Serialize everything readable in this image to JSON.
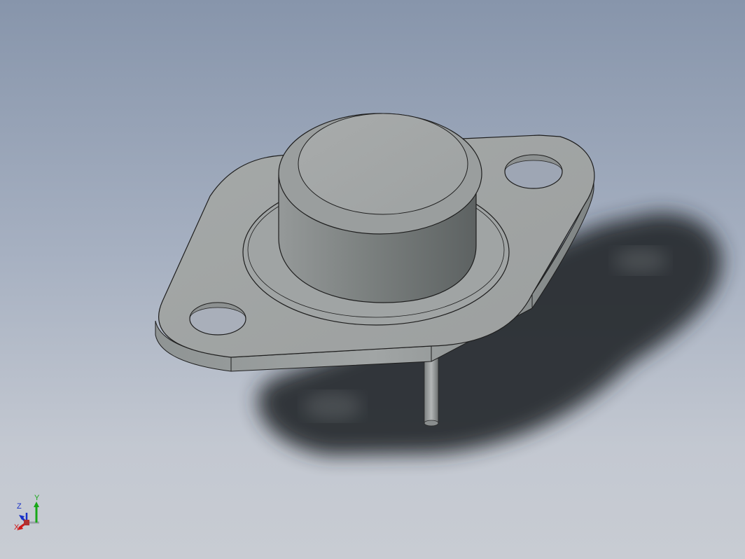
{
  "viewport": {
    "background_top": "#8795ab",
    "background_bottom": "#c8ccd3",
    "model_color": "#a3a7a6",
    "edge_color": "#1e1e1e"
  },
  "triad": {
    "x_label": "X",
    "y_label": "Y",
    "z_label": "Z",
    "x_color": "#d01818",
    "y_color": "#18a818",
    "z_color": "#1830c8"
  }
}
